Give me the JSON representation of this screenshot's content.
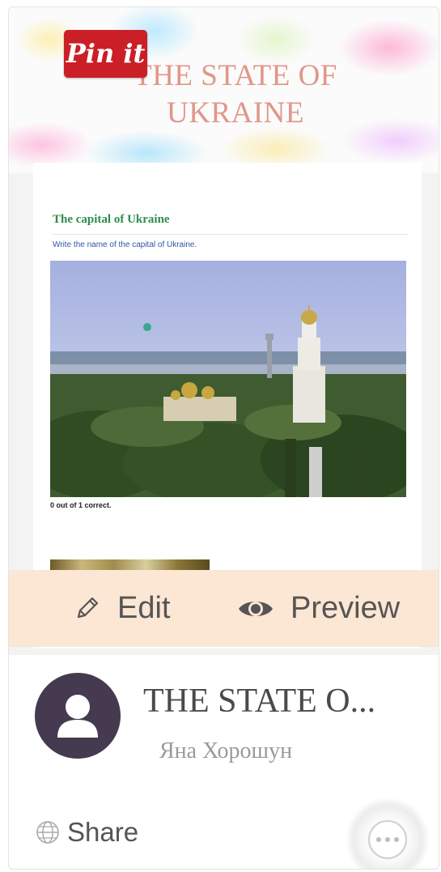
{
  "banner": {
    "title": "THE STATE OF UKRAINE"
  },
  "pinit": {
    "label": "Pin it"
  },
  "quiz": {
    "title": "The capital of Ukraine",
    "instructions": "Write the name of the capital of Ukraine.",
    "caption": "0 out of 1 correct."
  },
  "toolbar": {
    "edit_label": "Edit",
    "preview_label": "Preview"
  },
  "info": {
    "title": "THE STATE O...",
    "author": "Яна Хорошун",
    "share_label": "Share"
  },
  "colors": {
    "pinit": "#cb1f27",
    "toolbar_bg": "#fce6d4",
    "banner_title": "#e1968a",
    "avatar_bg": "#453a4f"
  }
}
